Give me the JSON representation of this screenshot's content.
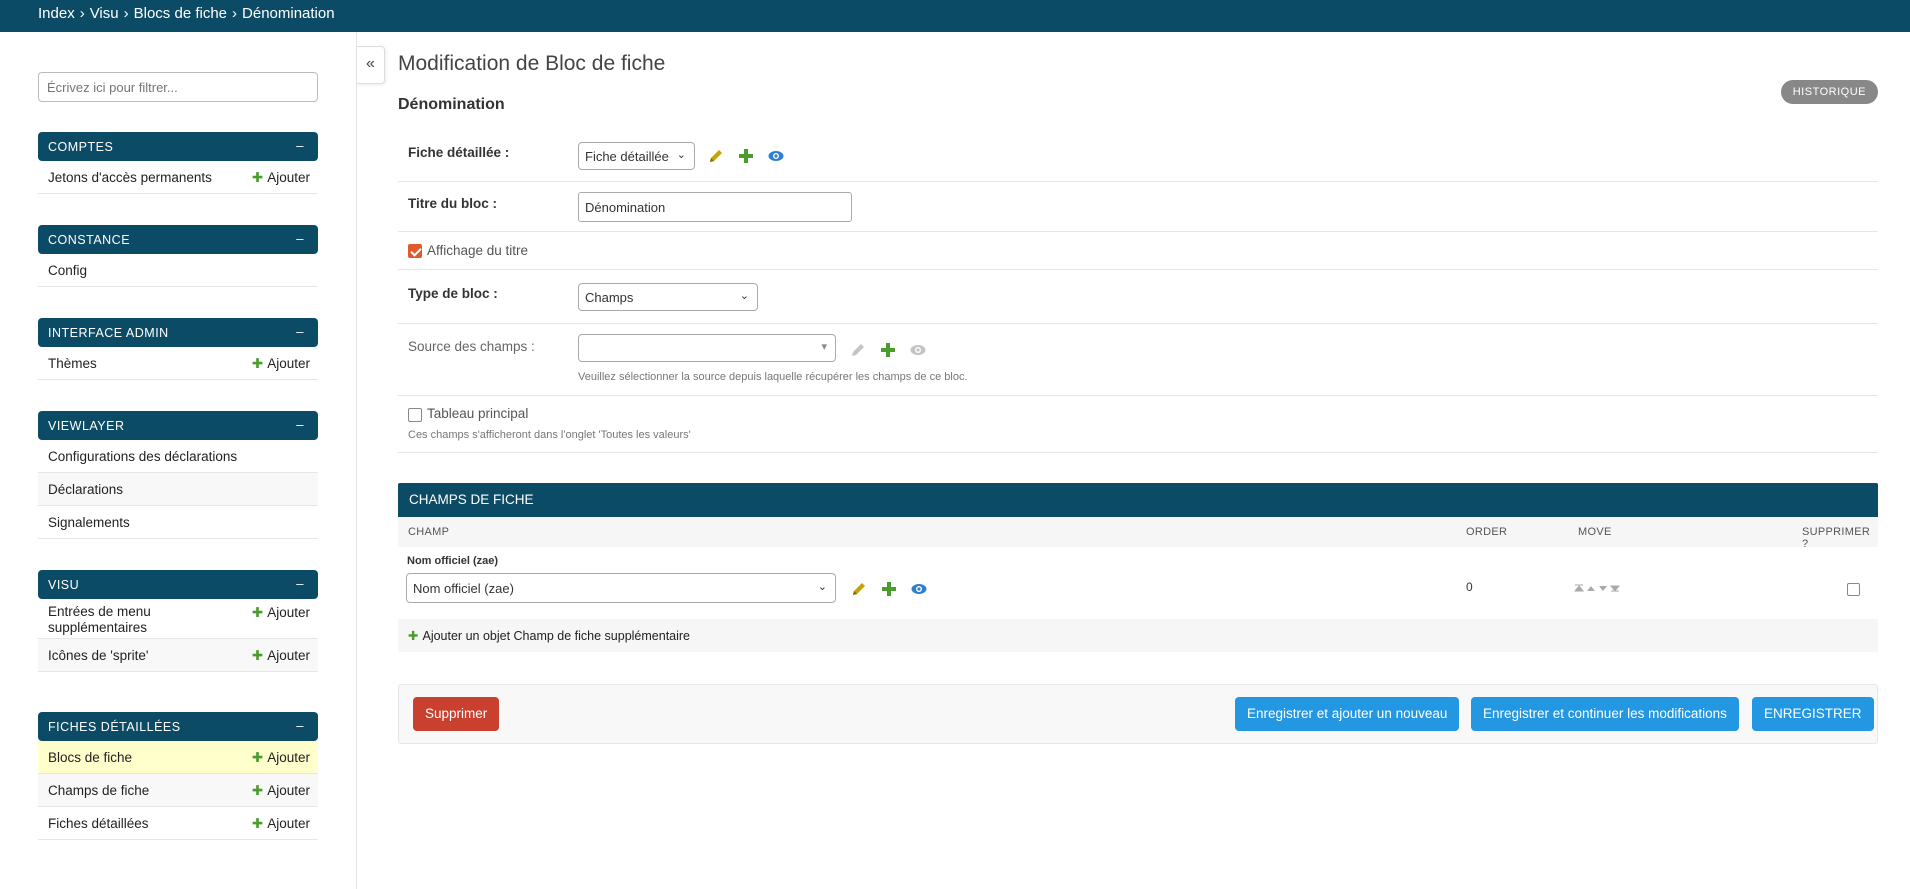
{
  "breadcrumb": [
    "Index",
    "Visu",
    "Blocs de fiche",
    "Dénomination"
  ],
  "sidebar": {
    "filter_placeholder": "Écrivez ici pour filtrer...",
    "modules": [
      {
        "title": "COMPTES",
        "items": [
          {
            "label": "Jetons d'accès permanents",
            "add": "Ajouter"
          }
        ]
      },
      {
        "title": "CONSTANCE",
        "items": [
          {
            "label": "Config"
          }
        ]
      },
      {
        "title": "INTERFACE ADMIN",
        "items": [
          {
            "label": "Thèmes",
            "add": "Ajouter"
          }
        ]
      },
      {
        "title": "VIEWLAYER",
        "items": [
          {
            "label": "Configurations des déclarations"
          },
          {
            "label": "Déclarations"
          },
          {
            "label": "Signalements"
          }
        ]
      },
      {
        "title": "VISU",
        "items": [
          {
            "label": "Entrées de menu supplémentaires",
            "add": "Ajouter"
          },
          {
            "label": "Icônes de 'sprite'",
            "add": "Ajouter"
          }
        ]
      },
      {
        "title": "FICHES DÉTAILLÉES",
        "items": [
          {
            "label": "Blocs de fiche",
            "add": "Ajouter"
          },
          {
            "label": "Champs de fiche",
            "add": "Ajouter"
          },
          {
            "label": "Fiches détaillées",
            "add": "Ajouter"
          }
        ]
      }
    ],
    "collapse_symbol": "–",
    "toggle_symbol": "«"
  },
  "main": {
    "title": "Modification de Bloc de fiche",
    "history_label": "HISTORIQUE",
    "object_name": "Dénomination",
    "fields": {
      "fiche_label": "Fiche détaillée :",
      "fiche_value": "Fiche détaillée",
      "titre_label": "Titre du bloc :",
      "titre_value": "Dénomination",
      "affichage_label": "Affichage du titre",
      "affichage_checked": true,
      "type_label": "Type de bloc :",
      "type_value": "Champs",
      "source_label": "Source des champs :",
      "source_value": "",
      "source_help": "Veuillez sélectionner la source depuis laquelle récupérer les champs de ce bloc.",
      "tableau_label": "Tableau principal",
      "tableau_checked": false,
      "tableau_help": "Ces champs s'afficheront dans l'onglet 'Toutes les valeurs'"
    },
    "inline": {
      "title": "CHAMPS DE FICHE",
      "columns": {
        "champ": "CHAMP",
        "order": "ORDER",
        "move": "MOVE",
        "delete": "SUPPRIMER ?"
      },
      "row": {
        "field_label": "Nom officiel (zae)",
        "field_value": "Nom officiel (zae)",
        "order": "0"
      },
      "add_label": "Ajouter un objet Champ de fiche supplémentaire"
    },
    "buttons": {
      "delete": "Supprimer",
      "save_add": "Enregistrer et ajouter un nouveau",
      "save_continue": "Enregistrer et continuer les modifications",
      "save": "ENREGISTRER"
    }
  },
  "colors": {
    "header": "#0c4b65",
    "accent": "#e2592b",
    "primary": "#2497e3",
    "danger": "#c9402f",
    "add_green": "#4a9d2c"
  }
}
